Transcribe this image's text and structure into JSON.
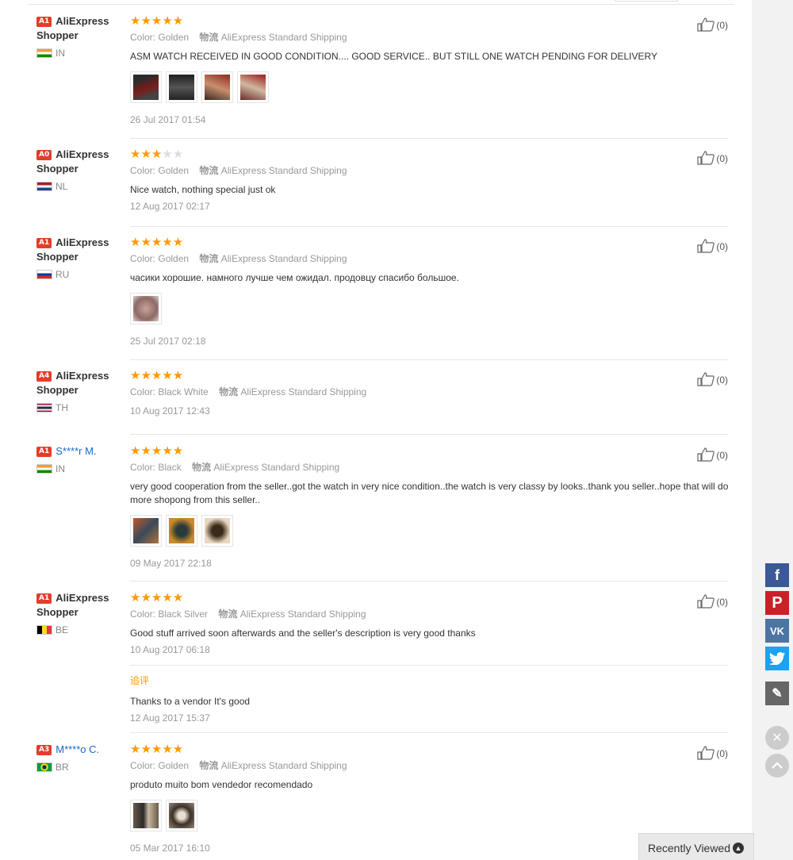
{
  "labels": {
    "color_label": "Color:",
    "shipping_label": "物流",
    "shipping_value": "AliExpress Standard Shipping",
    "additional_label": "追评"
  },
  "reviews": [
    {
      "badge": "A1",
      "user_line1": "AliExpress",
      "user_line2": "Shopper",
      "user_link": false,
      "country": "IN",
      "rating": 5,
      "color": "Golden",
      "text": "ASM WATCH RECEIVED IN GOOD CONDITION.... GOOD SERVICE.. BUT STILL ONE WATCH PENDING FOR DELIVERY",
      "date": "26 Jul 2017 01:54",
      "helpful": "(0)",
      "photo_count": 4
    },
    {
      "badge": "A0",
      "user_line1": "AliExpress",
      "user_line2": "Shopper",
      "user_link": false,
      "country": "NL",
      "rating": 3,
      "color": "Golden",
      "text": "Nice watch, nothing special just ok",
      "date": "12 Aug 2017 02:17",
      "helpful": "(0)",
      "photo_count": 0
    },
    {
      "badge": "A1",
      "user_line1": "AliExpress",
      "user_line2": "Shopper",
      "user_link": false,
      "country": "RU",
      "rating": 5,
      "color": "Golden",
      "text": "часики хорошие. намного лучше чем ожидал. продовцу спасибо большое.",
      "date": "25 Jul 2017 02:18",
      "helpful": "(0)",
      "photo_count": 1
    },
    {
      "badge": "A4",
      "user_line1": "AliExpress",
      "user_line2": "Shopper",
      "user_link": false,
      "country": "TH",
      "rating": 5,
      "color": "Black White",
      "text": "",
      "date": "10 Aug 2017 12:43",
      "helpful": "(0)",
      "photo_count": 0
    },
    {
      "badge": "A1",
      "user_line1": "S****r M.",
      "user_line2": "",
      "user_link": true,
      "country": "IN",
      "rating": 5,
      "color": "Black",
      "text": "very good cooperation from the seller..got the watch in very nice condition..the watch is very classy by looks..thank you seller..hope that will do more shopong from this seller..",
      "date": "09 May 2017 22:18",
      "helpful": "(0)",
      "photo_count": 3
    },
    {
      "badge": "A1",
      "user_line1": "AliExpress",
      "user_line2": "Shopper",
      "user_link": false,
      "country": "BE",
      "rating": 5,
      "color": "Black Silver",
      "text": "Good stuff arrived soon afterwards and the seller's description is very good thanks",
      "date": "10 Aug 2017 06:18",
      "helpful": "(0)",
      "photo_count": 0,
      "additional_text": "Thanks to a vendor It's good",
      "additional_date": "12 Aug 2017 15:37"
    },
    {
      "badge": "A3",
      "user_line1": "M****o C.",
      "user_line2": "",
      "user_link": true,
      "country": "BR",
      "rating": 5,
      "color": "Golden",
      "text": "produto muito bom vendedor recomendado",
      "date": "05 Mar 2017 16:10",
      "helpful": "(0)",
      "photo_count": 2
    }
  ],
  "social": [
    "facebook-icon",
    "pinterest-icon",
    "vk-icon",
    "twitter-icon",
    "edit-icon"
  ],
  "recently_viewed": "Recently Viewed",
  "colors": {
    "star": "#ff9900",
    "badge": "#e53c2b",
    "link": "#1b67c4",
    "additional": "#ff9900"
  }
}
